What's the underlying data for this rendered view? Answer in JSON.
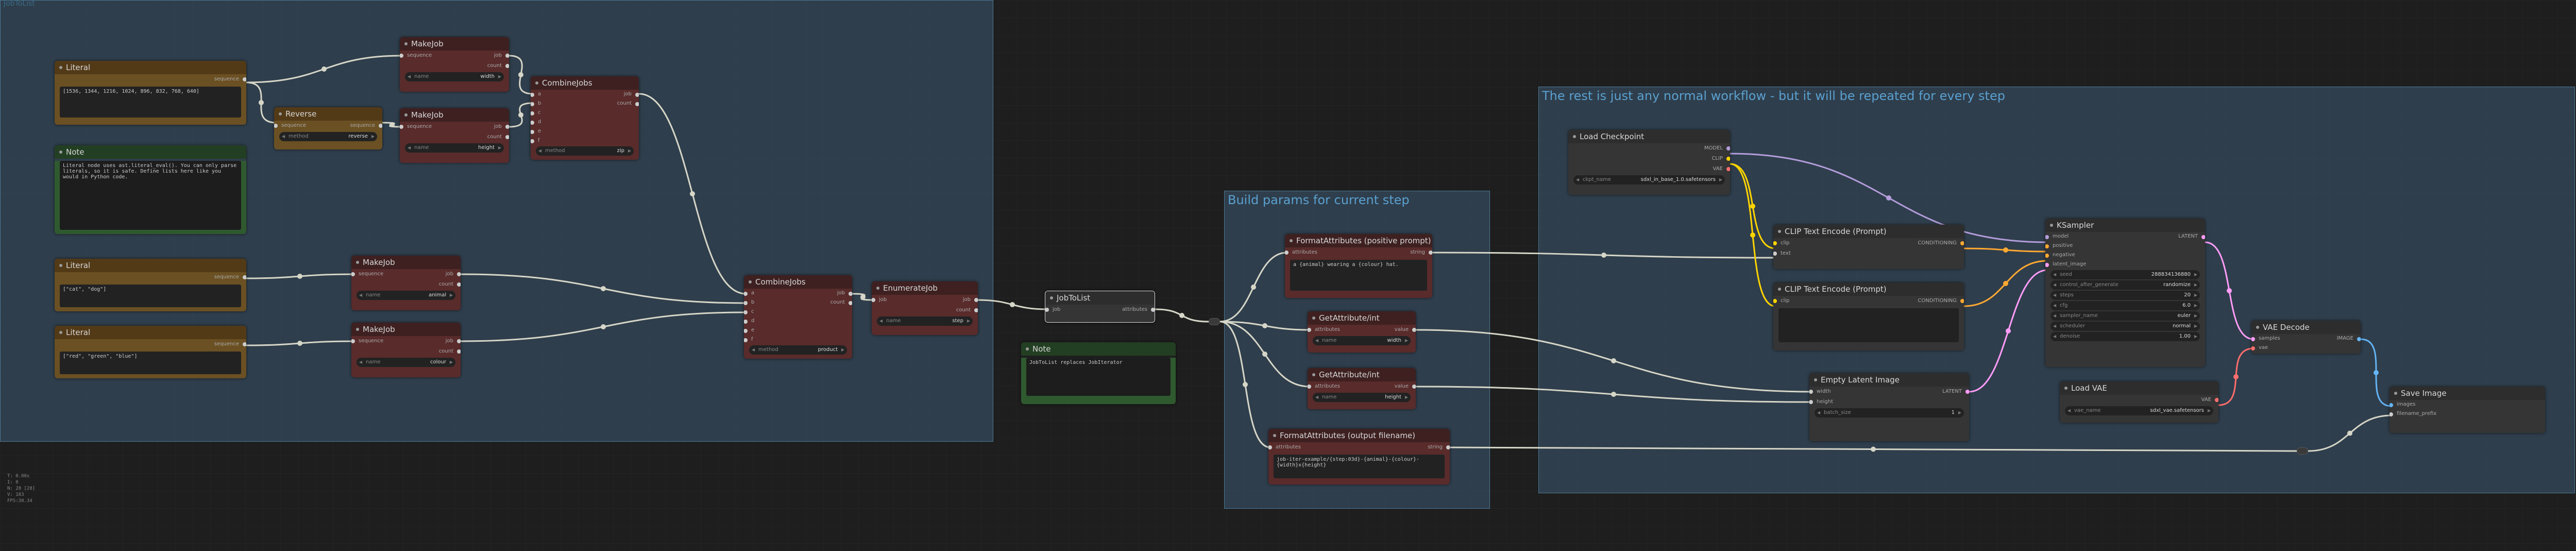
{
  "groups": {
    "first": {
      "title": "JobToList"
    },
    "build": {
      "title": "Build params for current step"
    },
    "rest": {
      "title": "The rest is just any normal workflow - but it will be repeated for every step"
    }
  },
  "nodes": {
    "literal1": {
      "title": "Literal",
      "out": "sequence",
      "text": "[1536, 1344, 1216, 1024, 896, 832, 768, 640]"
    },
    "reverse": {
      "title": "Reverse",
      "in": "sequence",
      "out": "sequence",
      "w_label": "method",
      "w_value": "reverse"
    },
    "note1": {
      "title": "Note",
      "text": "Literal node uses ast.literal_eval(). You can only parse literals, so it is safe. Define lists here like you would in Python code."
    },
    "literal2": {
      "title": "Literal",
      "out": "sequence",
      "text": "[\"cat\", \"dog\"]"
    },
    "literal3": {
      "title": "Literal",
      "out": "sequence",
      "text": "[\"red\", \"green\", \"blue\"]"
    },
    "makejob1": {
      "title": "MakeJob",
      "in": "sequence",
      "out1": "job",
      "out2": "count",
      "w_label": "name",
      "w_value": "width"
    },
    "makejob2": {
      "title": "MakeJob",
      "in": "sequence",
      "out1": "job",
      "out2": "count",
      "w_label": "name",
      "w_value": "height"
    },
    "makejob3": {
      "title": "MakeJob",
      "in": "sequence",
      "out1": "job",
      "out2": "count",
      "w_label": "name",
      "w_value": "animal"
    },
    "makejob4": {
      "title": "MakeJob",
      "in": "sequence",
      "out1": "job",
      "out2": "count",
      "w_label": "name",
      "w_value": "colour"
    },
    "combine1": {
      "title": "CombineJobs",
      "ins": [
        "a",
        "b",
        "c",
        "d",
        "e",
        "f"
      ],
      "out1": "job",
      "out2": "count",
      "w_label": "method",
      "w_value": "zip"
    },
    "combine2": {
      "title": "CombineJobs",
      "ins": [
        "a",
        "b",
        "c",
        "d",
        "e",
        "f"
      ],
      "out1": "job",
      "out2": "count",
      "w_label": "method",
      "w_value": "product"
    },
    "enumerate": {
      "title": "EnumerateJob",
      "in": "job",
      "out1": "job",
      "out2": "count",
      "w_label": "name",
      "w_value": "step"
    },
    "jobtolist": {
      "title": "JobToList",
      "in": "job",
      "out": "attributes"
    },
    "note2": {
      "title": "Note",
      "text": "JobToList replaces JobIterator"
    },
    "fmt_pos": {
      "title": "FormatAttributes (positive prompt)",
      "in": "attributes",
      "out": "string",
      "text": "a {animal} wearing a {colour} hat."
    },
    "getattr1": {
      "title": "GetAttribute/int",
      "in": "attributes",
      "out": "value",
      "w_label": "name",
      "w_value": "width"
    },
    "getattr2": {
      "title": "GetAttribute/int",
      "in": "attributes",
      "out": "value",
      "w_label": "name",
      "w_value": "height"
    },
    "fmt_out": {
      "title": "FormatAttributes (output filename)",
      "in": "attributes",
      "out": "string",
      "text": "job-iter-example/{step:03d}-{animal}-{colour}-{width}x{height}"
    },
    "ckpt": {
      "title": "Load Checkpoint",
      "out1": "MODEL",
      "out2": "CLIP",
      "out3": "VAE",
      "w_label": "ckpt_name",
      "w_value": "sdxl_in_base_1.0.safetensors"
    },
    "clip_pos": {
      "title": "CLIP Text Encode (Prompt)",
      "in1": "clip",
      "in2": "text",
      "out": "CONDITIONING"
    },
    "clip_neg": {
      "title": "CLIP Text Encode (Prompt)",
      "in1": "clip",
      "out": "CONDITIONING"
    },
    "latent": {
      "title": "Empty Latent Image",
      "in1": "width",
      "in2": "height",
      "out": "LATENT",
      "w_label": "batch_size",
      "w_value": "1"
    },
    "ksampler": {
      "title": "KSampler",
      "ins": [
        "model",
        "positive",
        "negative",
        "latent_image"
      ],
      "out": "LATENT",
      "widgets": [
        [
          "seed",
          "288834136880"
        ],
        [
          "control_after_generate",
          "randomize"
        ],
        [
          "steps",
          "20"
        ],
        [
          "cfg",
          "6.0"
        ],
        [
          "sampler_name",
          "euler"
        ],
        [
          "scheduler",
          "normal"
        ],
        [
          "denoise",
          "1.00"
        ]
      ]
    },
    "loadvae": {
      "title": "Load VAE",
      "out": "VAE",
      "w_label": "vae_name",
      "w_value": "sdxl_vae.safetensors"
    },
    "vaedecode": {
      "title": "VAE Decode",
      "in1": "samples",
      "in2": "vae",
      "out": "IMAGE"
    },
    "saveimage": {
      "title": "Save Image",
      "in1": "images",
      "in2": "filename_prefix"
    }
  },
  "info": [
    "T: 0.00s",
    "I: 0",
    "N: 28 [28]",
    "V: 183",
    "FPS:30.34"
  ],
  "colors": {
    "wire": "#d6d6c8",
    "clip": "#ffd500",
    "model": "#b39ddb",
    "latent": "#ff9cf9",
    "vae": "#ff6e6e",
    "image": "#64b5f6",
    "cond": "#ffa931"
  }
}
